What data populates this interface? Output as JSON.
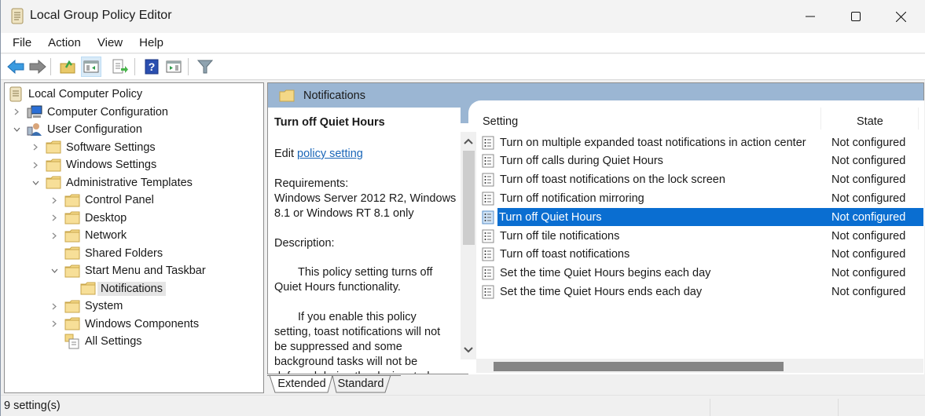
{
  "window": {
    "title": "Local Group Policy Editor",
    "icon": "scroll-policy-icon",
    "controls": {
      "minimize": "minimize-icon",
      "maximize": "maximize-icon",
      "close": "close-icon"
    }
  },
  "menubar": {
    "items": [
      "File",
      "Action",
      "View",
      "Help"
    ]
  },
  "toolbar": {
    "buttons": [
      {
        "name": "back-button",
        "icon": "arrow-left-icon"
      },
      {
        "name": "forward-button",
        "icon": "arrow-right-icon"
      },
      {
        "name": "up-one-level-button",
        "icon": "folder-up-icon"
      },
      {
        "name": "show-hide-console-tree-button",
        "icon": "console-tree-icon",
        "active": true
      },
      {
        "name": "export-list-button",
        "icon": "export-list-icon"
      },
      {
        "name": "help-button",
        "icon": "help-icon"
      },
      {
        "name": "show-hide-action-pane-button",
        "icon": "action-pane-icon"
      },
      {
        "name": "filter-button",
        "icon": "filter-icon"
      }
    ]
  },
  "tree": {
    "items": [
      {
        "label": "Local Computer Policy",
        "level": 0,
        "expander": "none",
        "icon": "scroll-policy-icon"
      },
      {
        "label": "Computer Configuration",
        "level": 1,
        "expander": "collapsed",
        "icon": "computer-icon"
      },
      {
        "label": "User Configuration",
        "level": 1,
        "expander": "expanded",
        "icon": "user-icon"
      },
      {
        "label": "Software Settings",
        "level": 2,
        "expander": "collapsed",
        "icon": "folder-icon"
      },
      {
        "label": "Windows Settings",
        "level": 2,
        "expander": "collapsed",
        "icon": "folder-icon"
      },
      {
        "label": "Administrative Templates",
        "level": 2,
        "expander": "expanded",
        "icon": "folder-icon"
      },
      {
        "label": "Control Panel",
        "level": 3,
        "expander": "collapsed",
        "icon": "folder-icon"
      },
      {
        "label": "Desktop",
        "level": 3,
        "expander": "collapsed",
        "icon": "folder-icon"
      },
      {
        "label": "Network",
        "level": 3,
        "expander": "collapsed",
        "icon": "folder-icon"
      },
      {
        "label": "Shared Folders",
        "level": 3,
        "expander": "none",
        "icon": "folder-icon"
      },
      {
        "label": "Start Menu and Taskbar",
        "level": 3,
        "expander": "expanded",
        "icon": "folder-icon"
      },
      {
        "label": "Notifications",
        "level": 4,
        "expander": "none",
        "icon": "folder-icon",
        "selected": true
      },
      {
        "label": "System",
        "level": 3,
        "expander": "collapsed",
        "icon": "folder-icon"
      },
      {
        "label": "Windows Components",
        "level": 3,
        "expander": "collapsed",
        "icon": "folder-icon"
      },
      {
        "label": "All Settings",
        "level": 3,
        "expander": "none",
        "icon": "all-settings-icon"
      }
    ]
  },
  "details": {
    "header": "Notifications",
    "selected_title": "Turn off Quiet Hours",
    "edit_prefix": "Edit ",
    "edit_link": "policy setting ",
    "requirements_label": "Requirements:",
    "requirements_line1": "Windows Server 2012 R2, Windows",
    "requirements_line2": "8.1 or Windows RT 8.1 only",
    "description_label": "Description:",
    "desc_para1_line1": "This policy setting turns off",
    "desc_para1_line2": "Quiet Hours functionality.",
    "desc_para2_line1": "If you enable this policy",
    "desc_para2_line2": "setting, toast notifications will not",
    "desc_para2_line3": "be suppressed and some",
    "desc_para2_line4": "background tasks will not be",
    "desc_para2_line5": "deferred during the designated"
  },
  "list": {
    "columns": [
      "Setting",
      "State"
    ],
    "rows": [
      {
        "setting": "Turn on multiple expanded toast notifications in action center",
        "state": "Not configured"
      },
      {
        "setting": "Turn off calls during Quiet Hours",
        "state": "Not configured"
      },
      {
        "setting": "Turn off toast notifications on the lock screen",
        "state": "Not configured"
      },
      {
        "setting": "Turn off notification mirroring",
        "state": "Not configured"
      },
      {
        "setting": "Turn off Quiet Hours",
        "state": "Not configured",
        "selected": true
      },
      {
        "setting": "Turn off tile notifications",
        "state": "Not configured"
      },
      {
        "setting": "Turn off toast notifications",
        "state": "Not configured"
      },
      {
        "setting": "Set the time Quiet Hours begins each day",
        "state": "Not configured"
      },
      {
        "setting": "Set the time Quiet Hours ends each day",
        "state": "Not configured"
      }
    ],
    "vertical_scroll_position": 0.15,
    "horizontal_scroll_fraction_visible": 0.65
  },
  "tabs": {
    "items": [
      "Extended",
      "Standard"
    ],
    "active": "Extended"
  },
  "statusbar": {
    "text": "9 setting(s)"
  },
  "colors": {
    "header_bg": "#9bb6d3",
    "selection_bg": "#0a6ed1",
    "link": "#1a66b8",
    "tree_selection_bg": "#e5e5e5"
  }
}
